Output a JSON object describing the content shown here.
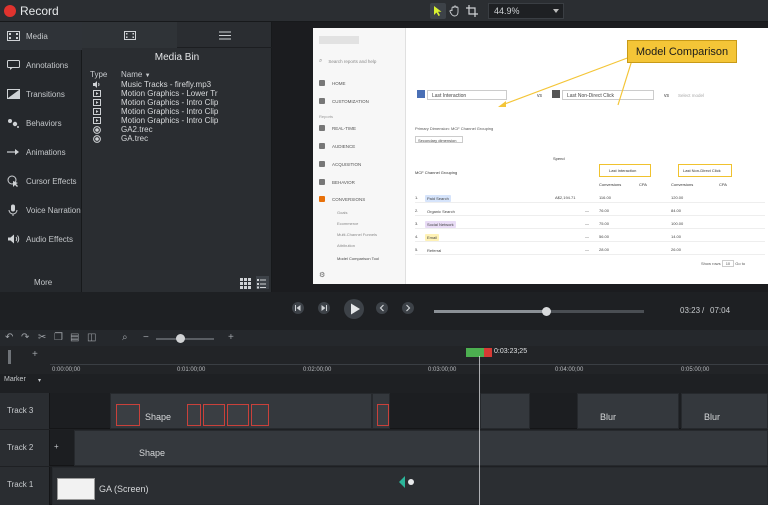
{
  "app": {
    "record_label": "Record",
    "zoom_value": "44.9%"
  },
  "tools": [
    {
      "name": "tool-media",
      "label": "Media",
      "icon": "film-icon"
    },
    {
      "name": "tool-annotations",
      "label": "Annotations",
      "icon": "annotation-icon"
    },
    {
      "name": "tool-transitions",
      "label": "Transitions",
      "icon": "transition-icon"
    },
    {
      "name": "tool-behaviors",
      "label": "Behaviors",
      "icon": "behaviors-icon"
    },
    {
      "name": "tool-animations",
      "label": "Animations",
      "icon": "animation-icon"
    },
    {
      "name": "tool-cursor-effects",
      "label": "Cursor Effects",
      "icon": "cursor-icon"
    },
    {
      "name": "tool-voice-narration",
      "label": "Voice Narration",
      "icon": "microphone-icon"
    },
    {
      "name": "tool-audio-effects",
      "label": "Audio Effects",
      "icon": "speaker-icon"
    }
  ],
  "more_label": "More",
  "media_bin": {
    "title": "Media Bin",
    "col_type": "Type",
    "col_name": "Name",
    "files": [
      {
        "name": "Music Tracks - firefly.mp3",
        "type": "audio"
      },
      {
        "name": "Motion Graphics - Lower Tr",
        "type": "video"
      },
      {
        "name": "Motion Graphics - Intro Clip",
        "type": "video"
      },
      {
        "name": "Motion Graphics - Intro Clip",
        "type": "video"
      },
      {
        "name": "Motion Graphics - Intro Clip",
        "type": "video"
      },
      {
        "name": "GA2.trec",
        "type": "recording"
      },
      {
        "name": "GA.trec",
        "type": "recording"
      }
    ]
  },
  "canvas": {
    "callout": "Model Comparison",
    "ga": {
      "search_placeholder": "Search reports and help",
      "nav": [
        "HOME",
        "CUSTOMIZATION",
        "REAL-TIME",
        "AUDIENCE",
        "ACQUISITION",
        "BEHAVIOR",
        "CONVERSIONS"
      ],
      "reports_label": "Reports",
      "subnav": [
        "Goals",
        "Ecommerce",
        "Multi-Channel Funnels",
        "Attribution",
        "Model Comparison Tool"
      ],
      "model_a": "Last Interaction",
      "vs": "vs",
      "model_b": "Last Non-Direct Click",
      "select_model": "Select model",
      "primary_dimension": "Primary Dimension: MCF Channel Grouping",
      "secondary_dimension": "Secondary dimension",
      "col_dimension": "MCF Channel Grouping",
      "col_spend": "Spend",
      "col_a_head": "Last Interaction",
      "col_b_head": "Last Non-Direct Click",
      "col_conversions": "Conversions",
      "col_cpa": "CPA",
      "rows": [
        {
          "n": "1.",
          "channel": "Paid Search",
          "color": "#d6e4fb",
          "spend": "A$2,194.71",
          "conv_a": "116.00",
          "conv_b": "120.00"
        },
        {
          "n": "2.",
          "channel": "Organic Search",
          "color": "#fbfbfb",
          "spend": "—",
          "conv_a": "76.00",
          "conv_b": "84.00"
        },
        {
          "n": "3.",
          "channel": "Social Network",
          "color": "#e9dcf6",
          "spend": "—",
          "conv_a": "75.00",
          "conv_b": "100.00"
        },
        {
          "n": "4.",
          "channel": "Email",
          "color": "#fff2b6",
          "spend": "—",
          "conv_a": "56.00",
          "conv_b": "14.00"
        },
        {
          "n": "5.",
          "channel": "Referral",
          "color": "#fbfbfb",
          "spend": "—",
          "conv_a": "28.00",
          "conv_b": "26.00"
        }
      ],
      "show_rows": "Show rows",
      "go_to": "Go to"
    }
  },
  "playback": {
    "current_time": "03:23",
    "separator": "/",
    "total_time": "07:04"
  },
  "ruler": {
    "playhead_time": "0:03:23;25",
    "ticks": [
      "0:00:00;00",
      "0:01:00;00",
      "0:02:00;00",
      "0:03:00;00",
      "0:04:00;00",
      "0:05:00;00"
    ]
  },
  "timeline": {
    "marker_label": "Marker",
    "tracks": [
      {
        "label": "Track 3",
        "clips": [
          "Shape",
          "Blur",
          "Blur"
        ]
      },
      {
        "label": "Track 2",
        "clips": [
          "Shape"
        ]
      },
      {
        "label": "Track 1",
        "clips": [
          "GA (Screen)"
        ]
      }
    ]
  },
  "colors": {
    "record": "#e0332e",
    "accent_callout": "#f4c537",
    "playhead_green": "#4caf50",
    "playhead_red": "#d63a34"
  }
}
